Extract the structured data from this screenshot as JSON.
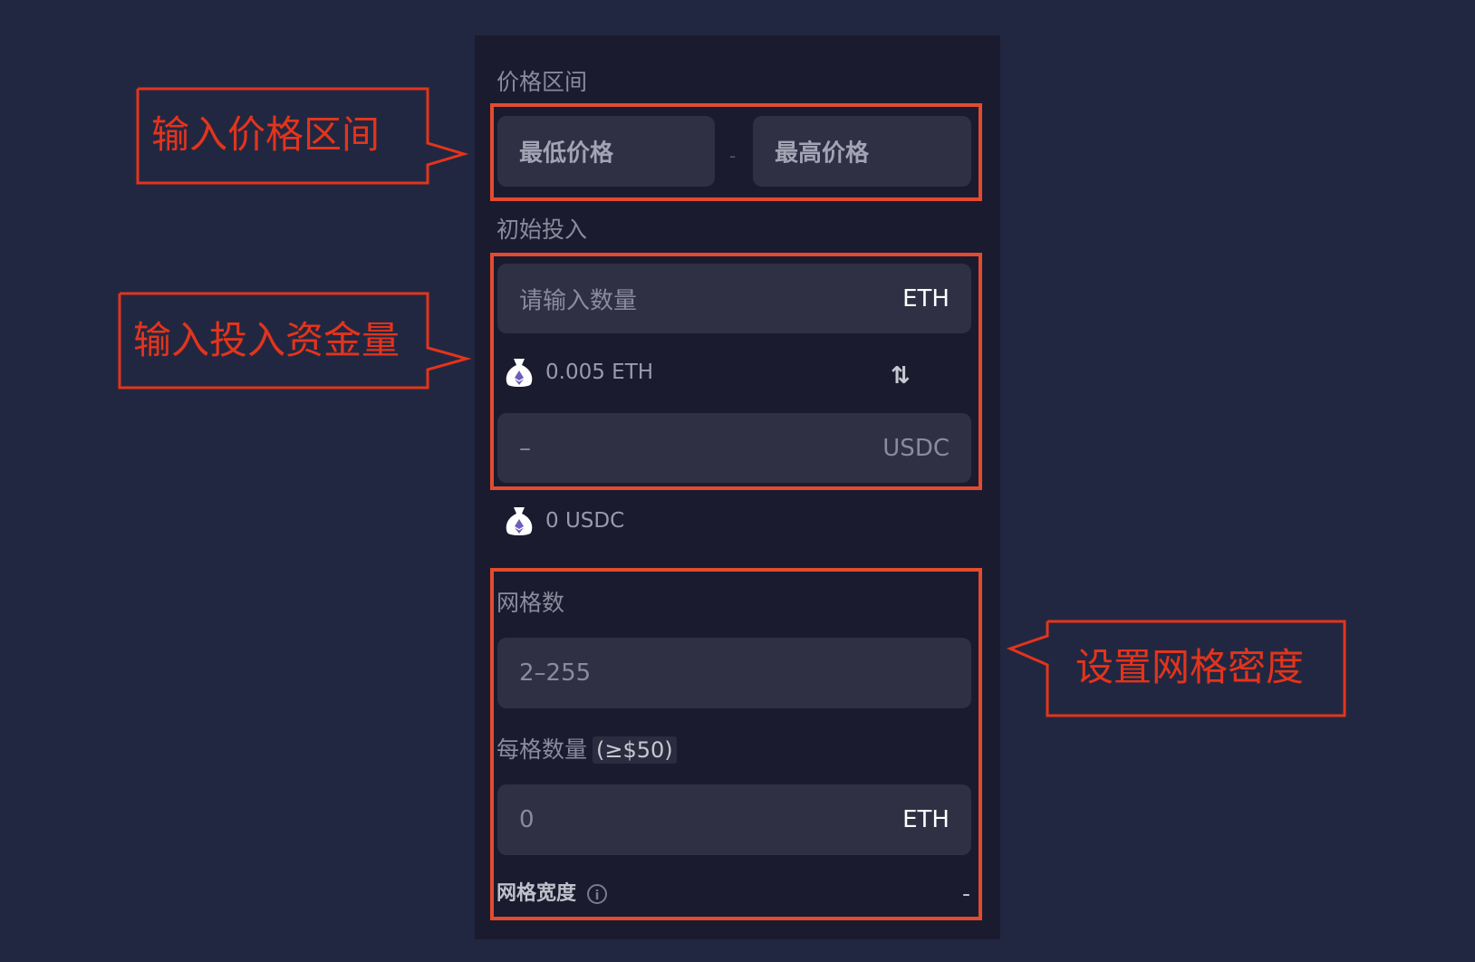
{
  "price_range": {
    "label": "价格区间",
    "min_placeholder": "最低价格",
    "separator": "-",
    "max_placeholder": "最高价格"
  },
  "initial_investment": {
    "label": "初始投入",
    "eth_placeholder": "请输入数量",
    "eth_unit": "ETH",
    "eth_balance": "0.005 ETH",
    "usdc_value": "–",
    "usdc_unit": "USDC",
    "usdc_balance": "0 USDC",
    "swap_icon": "swap-arrows-icon"
  },
  "grid": {
    "count_label": "网格数",
    "count_placeholder": "2–255",
    "per_grid_label": "每格数量",
    "per_grid_min": "(≥$50)",
    "per_grid_value": "0",
    "per_grid_unit": "ETH",
    "width_label": "网格宽度",
    "width_value": "-"
  },
  "annotations": {
    "price_range": "输入价格区间",
    "investment": "输入投入资金量",
    "grid_density": "设置网格密度",
    "color": "#e3341c"
  }
}
